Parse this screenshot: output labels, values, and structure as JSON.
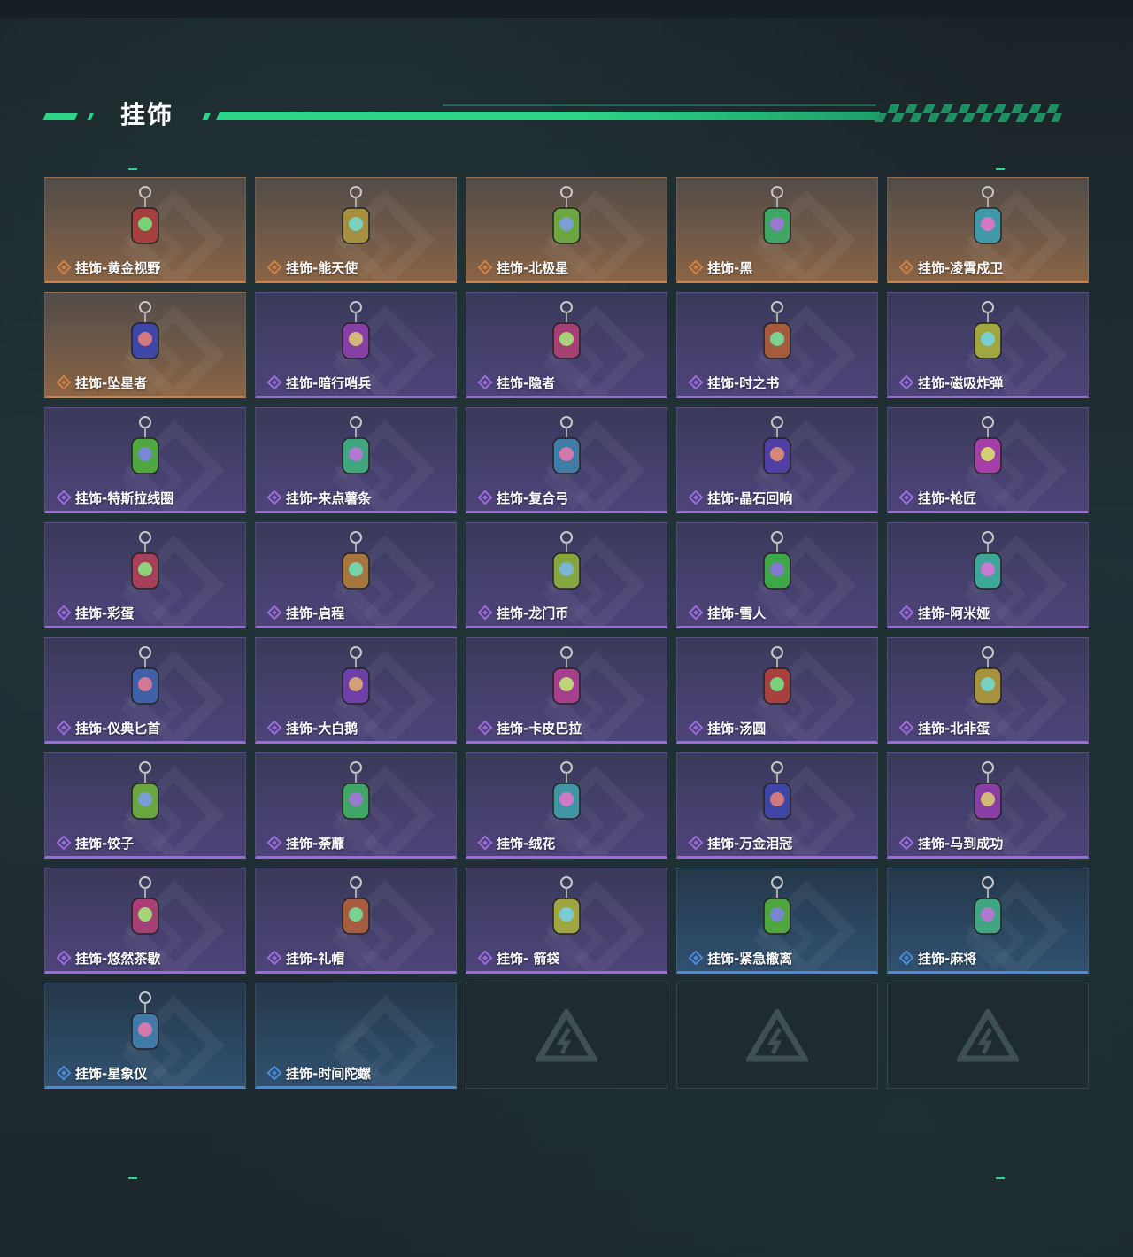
{
  "header": {
    "title": "挂饰"
  },
  "colors": {
    "accent": "#2fd38a",
    "gold": "#d08045",
    "purple": "#9b6bdb",
    "blue": "#4a8ad8"
  },
  "items": [
    {
      "label": "挂饰-黄金视野",
      "rarity": "gold",
      "icon": "charm-icon"
    },
    {
      "label": "挂饰-能天使",
      "rarity": "gold",
      "icon": "charm-icon"
    },
    {
      "label": "挂饰-北极星",
      "rarity": "gold",
      "icon": "charm-icon"
    },
    {
      "label": "挂饰-黑",
      "rarity": "gold",
      "icon": "charm-icon"
    },
    {
      "label": "挂饰-凌霄戍卫",
      "rarity": "gold",
      "icon": "charm-icon"
    },
    {
      "label": "挂饰-坠星者",
      "rarity": "gold",
      "icon": "charm-icon"
    },
    {
      "label": "挂饰-暗行哨兵",
      "rarity": "purple",
      "icon": "charm-icon"
    },
    {
      "label": "挂饰-隐者",
      "rarity": "purple",
      "icon": "charm-icon"
    },
    {
      "label": "挂饰-时之书",
      "rarity": "purple",
      "icon": "charm-icon"
    },
    {
      "label": "挂饰-磁吸炸弹",
      "rarity": "purple",
      "icon": "charm-icon"
    },
    {
      "label": "挂饰-特斯拉线圈",
      "rarity": "purple",
      "icon": "charm-icon"
    },
    {
      "label": "挂饰-来点薯条",
      "rarity": "purple",
      "icon": "charm-icon"
    },
    {
      "label": "挂饰-复合弓",
      "rarity": "purple",
      "icon": "charm-icon"
    },
    {
      "label": "挂饰-晶石回响",
      "rarity": "purple",
      "icon": "charm-icon"
    },
    {
      "label": "挂饰-枪匠",
      "rarity": "purple",
      "icon": "charm-icon"
    },
    {
      "label": "挂饰-彩蛋",
      "rarity": "purple",
      "icon": "charm-icon"
    },
    {
      "label": "挂饰-启程",
      "rarity": "purple",
      "icon": "charm-icon"
    },
    {
      "label": "挂饰-龙门币",
      "rarity": "purple",
      "icon": "charm-icon"
    },
    {
      "label": "挂饰-雪人",
      "rarity": "purple",
      "icon": "charm-icon"
    },
    {
      "label": "挂饰-阿米娅",
      "rarity": "purple",
      "icon": "charm-icon"
    },
    {
      "label": "挂饰-仪典匕首",
      "rarity": "purple",
      "icon": "charm-icon"
    },
    {
      "label": "挂饰-大白鹅",
      "rarity": "purple",
      "icon": "charm-icon"
    },
    {
      "label": "挂饰-卡皮巴拉",
      "rarity": "purple",
      "icon": "charm-icon"
    },
    {
      "label": "挂饰-汤圆",
      "rarity": "purple",
      "icon": "charm-icon"
    },
    {
      "label": "挂饰-北非蛋",
      "rarity": "purple",
      "icon": "charm-icon"
    },
    {
      "label": "挂饰-饺子",
      "rarity": "purple",
      "icon": "charm-icon"
    },
    {
      "label": "挂饰-荼蘼",
      "rarity": "purple",
      "icon": "charm-icon"
    },
    {
      "label": "挂饰-绒花",
      "rarity": "purple",
      "icon": "charm-icon"
    },
    {
      "label": "挂饰-万金泪冠",
      "rarity": "purple",
      "icon": "charm-icon"
    },
    {
      "label": "挂饰-马到成功",
      "rarity": "purple",
      "icon": "charm-icon"
    },
    {
      "label": "挂饰-悠然茶歇",
      "rarity": "purple",
      "icon": "charm-icon"
    },
    {
      "label": "挂饰-礼帽",
      "rarity": "purple",
      "icon": "charm-icon"
    },
    {
      "label": "挂饰- 箭袋",
      "rarity": "purple",
      "icon": "charm-icon"
    },
    {
      "label": "挂饰-紧急撤离",
      "rarity": "blue",
      "icon": "charm-icon"
    },
    {
      "label": "挂饰-麻将",
      "rarity": "blue",
      "icon": "charm-icon"
    },
    {
      "label": "挂饰-星象仪",
      "rarity": "blue",
      "icon": "charm-icon"
    },
    {
      "label": "挂饰-时间陀螺",
      "rarity": "blue",
      "icon": "none"
    },
    {
      "label": "",
      "rarity": "empty",
      "icon": "empty-slot-logo-icon"
    },
    {
      "label": "",
      "rarity": "empty",
      "icon": "empty-slot-logo-icon"
    },
    {
      "label": "",
      "rarity": "empty",
      "icon": "empty-slot-logo-icon"
    }
  ]
}
